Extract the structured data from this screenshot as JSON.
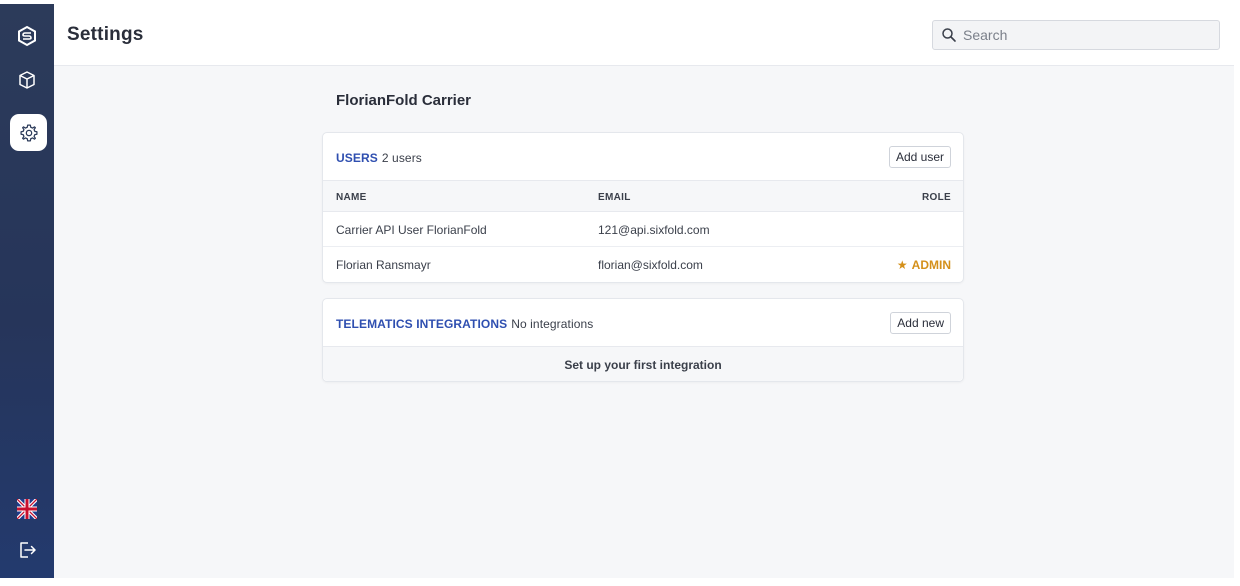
{
  "sidebar": {
    "items": [
      {
        "icon": "logo-icon"
      },
      {
        "icon": "package-icon"
      },
      {
        "icon": "gear-icon",
        "active": true
      }
    ],
    "bottom": [
      {
        "icon": "uk-flag-icon"
      },
      {
        "icon": "logout-icon"
      }
    ]
  },
  "header": {
    "title": "Settings",
    "search_placeholder": "Search"
  },
  "company": {
    "name": "FlorianFold Carrier"
  },
  "users": {
    "title": "USERS",
    "count": "2 users",
    "add_label": "Add user",
    "columns": {
      "name": "NAME",
      "email": "EMAIL",
      "role": "ROLE"
    },
    "rows": [
      {
        "name": "Carrier API User FlorianFold",
        "email": "121@api.sixfold.com",
        "role": ""
      },
      {
        "name": "Florian Ransmayr",
        "email": "florian@sixfold.com",
        "role": "ADMIN"
      }
    ]
  },
  "integrations": {
    "title": "TELEMATICS INTEGRATIONS",
    "count": "No integrations",
    "add_label": "Add new",
    "empty_text": "Set up your first integration"
  },
  "colors": {
    "sidebar": "#26355a",
    "accent": "#2f4fb0",
    "admin": "#d4901a"
  }
}
